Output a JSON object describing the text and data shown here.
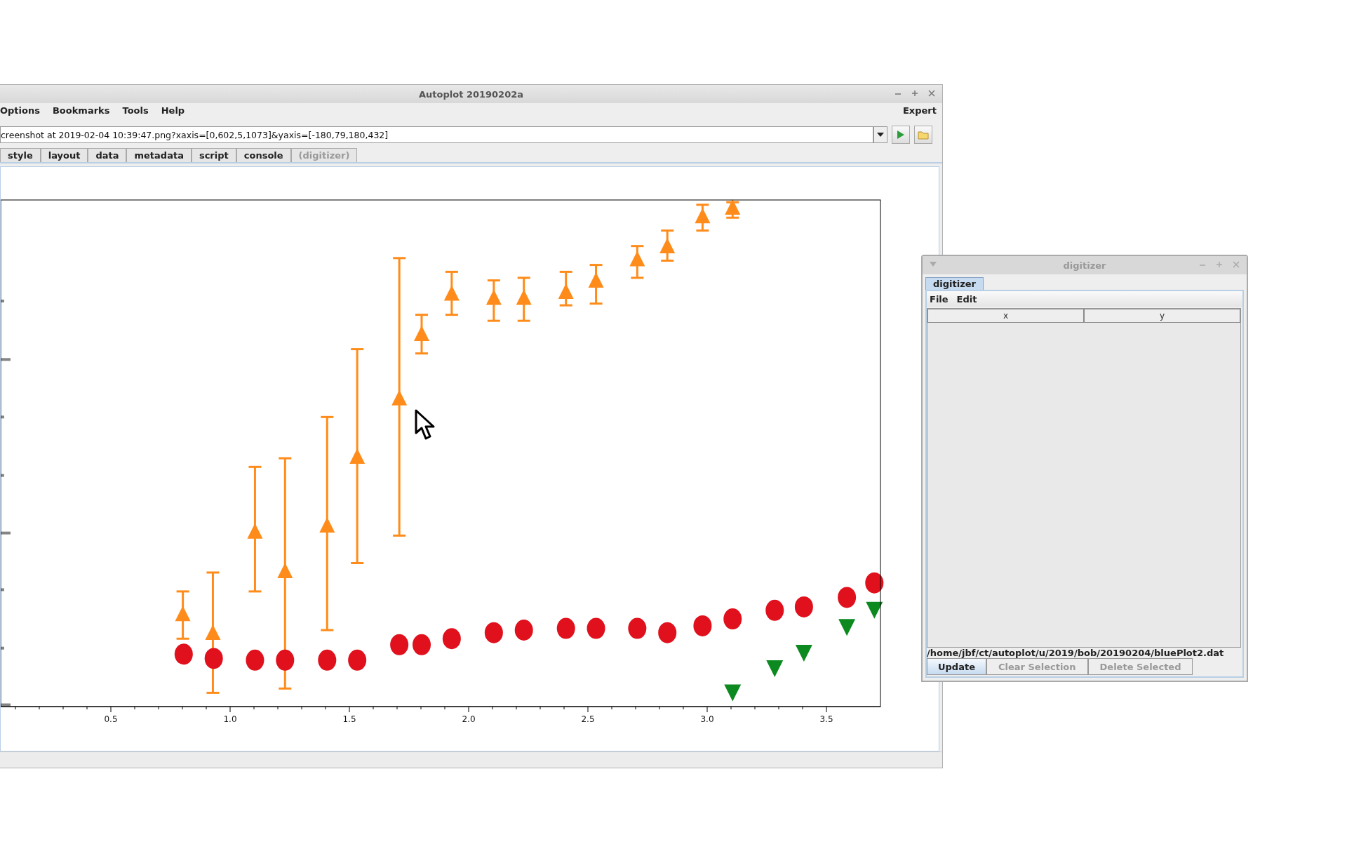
{
  "main_window": {
    "title": "Autoplot 20190202a",
    "menu": [
      "Options",
      "Bookmarks",
      "Tools",
      "Help"
    ],
    "expert_label": "Expert",
    "uri_field": {
      "value": "creenshot at 2019-02-04 10:39:47.png?xaxis=[0,602,5,1073]&yaxis=[-180,79,180,432]"
    },
    "tabs": [
      {
        "label": "style",
        "disabled": false
      },
      {
        "label": "layout",
        "disabled": false
      },
      {
        "label": "data",
        "disabled": false
      },
      {
        "label": "metadata",
        "disabled": false
      },
      {
        "label": "script",
        "disabled": false
      },
      {
        "label": "console",
        "disabled": false
      },
      {
        "label": "(digitizer)",
        "disabled": true
      }
    ],
    "x_axis_ticks": [
      "0.5",
      "1.0",
      "1.5",
      "2.0",
      "2.5",
      "3.0",
      "3.5"
    ]
  },
  "digitizer_window": {
    "title": "digitizer",
    "tabs": [
      {
        "label": "digitizer",
        "selected": true
      }
    ],
    "menu": [
      "File",
      "Edit"
    ],
    "table": {
      "columns": [
        "x",
        "y"
      ]
    },
    "file_path": "/home/jbf/ct/autoplot/u/2019/bob/20190204/bluePlot2.dat",
    "buttons": [
      {
        "label": "Update",
        "disabled": false
      },
      {
        "label": "Clear Selection",
        "disabled": true
      },
      {
        "label": "Delete Selected",
        "disabled": true
      }
    ]
  }
}
